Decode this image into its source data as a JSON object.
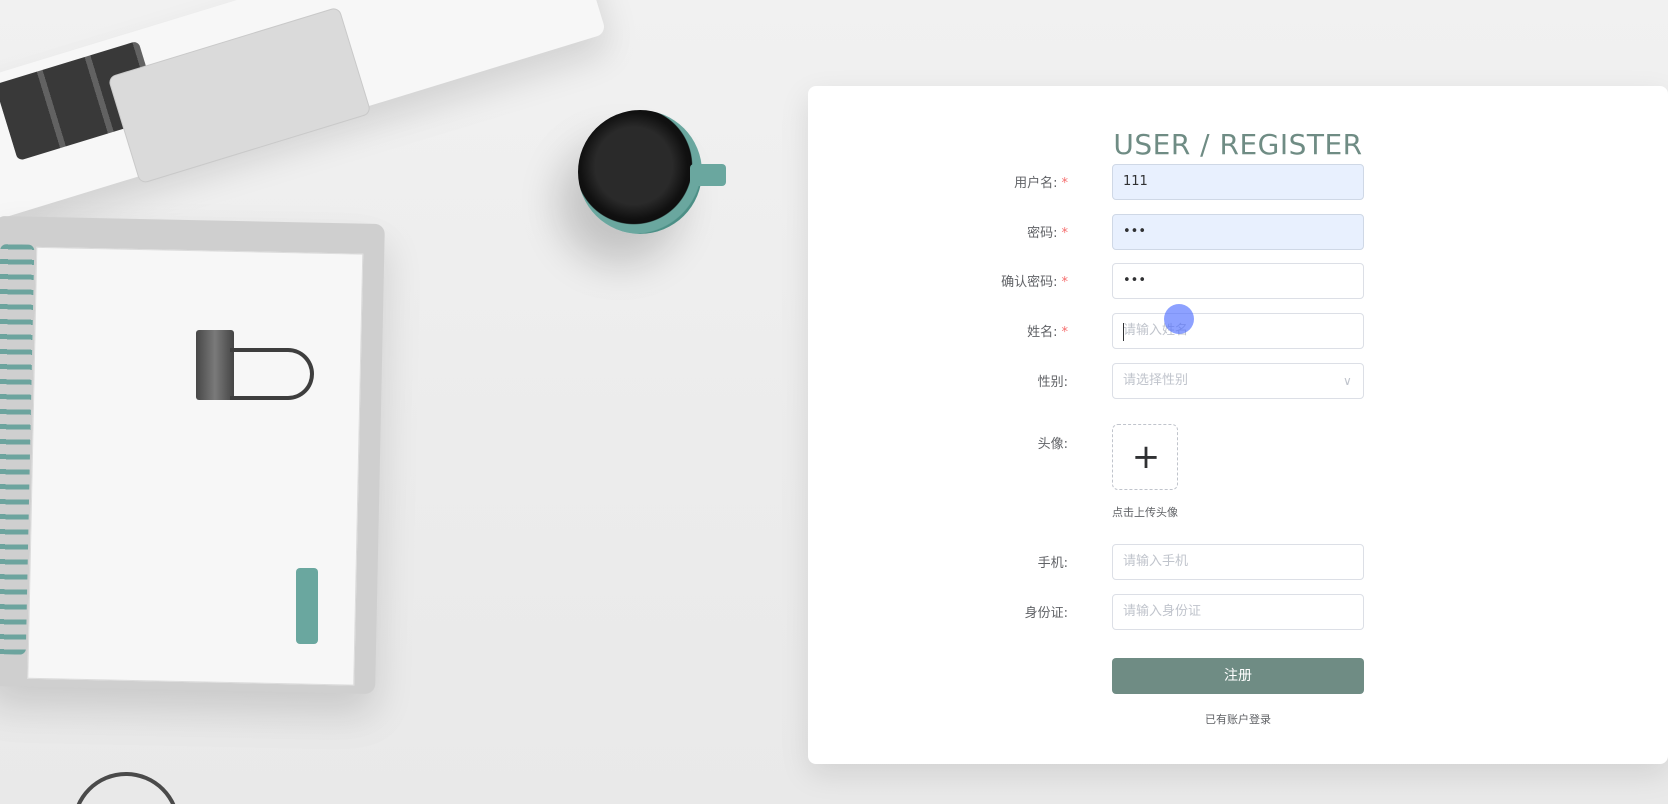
{
  "form": {
    "title": "USER / REGISTER",
    "required_mark": "*",
    "fields": {
      "username": {
        "label": "用户名:",
        "value": "111",
        "placeholder": ""
      },
      "password": {
        "label": "密码:",
        "value": "•••",
        "placeholder": ""
      },
      "confirm_password": {
        "label": "确认密码:",
        "value": "•••",
        "placeholder": ""
      },
      "name": {
        "label": "姓名:",
        "value": "",
        "placeholder": "请输入姓名"
      },
      "gender": {
        "label": "性别:",
        "value": "",
        "placeholder": "请选择性别"
      },
      "avatar": {
        "label": "头像:",
        "hint": "点击上传头像"
      },
      "phone": {
        "label": "手机:",
        "value": "",
        "placeholder": "请输入手机"
      },
      "id_card": {
        "label": "身份证:",
        "value": "",
        "placeholder": "请输入身份证"
      }
    },
    "submit_label": "注册",
    "login_link": "已有账户登录"
  },
  "icons": {
    "upload": "plus-icon",
    "dropdown": "chevron-down-icon"
  },
  "colors": {
    "accent": "#6f8c84",
    "required": "#f56c6c",
    "autofill": "#e8f0fe"
  }
}
